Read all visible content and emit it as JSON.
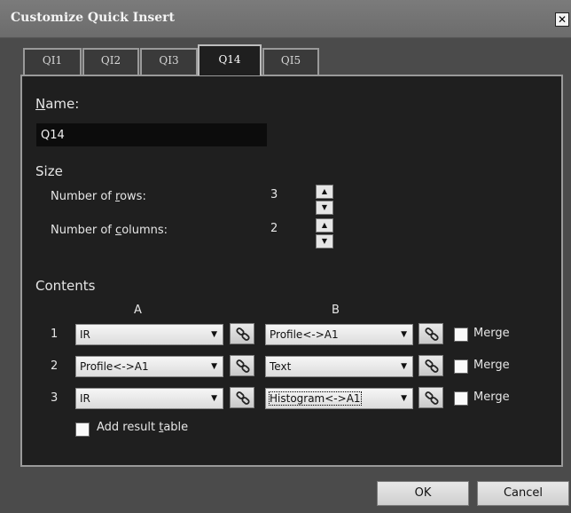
{
  "window": {
    "title": "Customize Quick Insert",
    "close_glyph": "✕"
  },
  "tabs": [
    {
      "label": "QI1",
      "active": false
    },
    {
      "label": "QI2",
      "active": false
    },
    {
      "label": "QI3",
      "active": false
    },
    {
      "label": "Q14",
      "active": true
    },
    {
      "label": "QI5",
      "active": false
    }
  ],
  "name_section": {
    "label_accel": "N",
    "label_rest": "ame:",
    "value": "Q14"
  },
  "size_section": {
    "heading": "Size",
    "rows_label_pre": "Number of ",
    "rows_label_accel": "r",
    "rows_label_post": "ows:",
    "rows_value": "3",
    "cols_label_pre": "Number of ",
    "cols_label_accel": "c",
    "cols_label_post": "olumns:",
    "cols_value": "2"
  },
  "contents": {
    "heading": "Contents",
    "col_a": "A",
    "col_b": "B",
    "rows": [
      {
        "num": "1",
        "a": "IR",
        "b": "Profile<->A1",
        "merge_label": "Merge",
        "merge_checked": false
      },
      {
        "num": "2",
        "a": "Profile<->A1",
        "b": "Text",
        "merge_label": "Merge",
        "merge_checked": false
      },
      {
        "num": "3",
        "a": "IR",
        "b": "Histogram<->A1",
        "merge_label": "Merge",
        "merge_checked": false
      }
    ],
    "add_table_pre": "Add result ",
    "add_table_accel": "t",
    "add_table_post": "able",
    "add_table_checked": false
  },
  "buttons": {
    "ok": "OK",
    "cancel": "Cancel"
  },
  "colors": {
    "panel_bg": "#1f1f1f",
    "outer_bg": "#4b4b4b",
    "titlebar": "#757575"
  }
}
